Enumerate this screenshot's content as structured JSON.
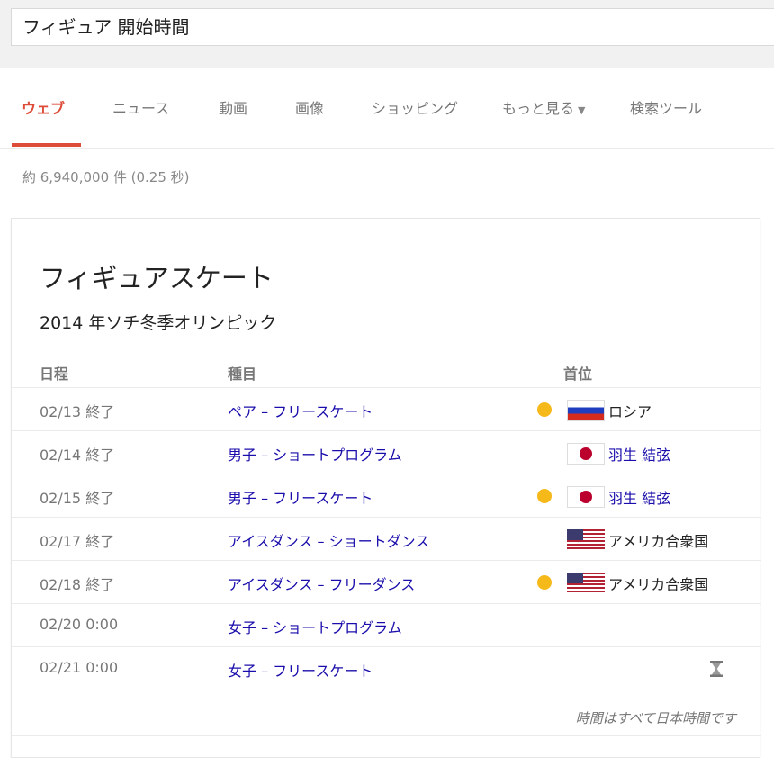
{
  "search": {
    "query": "フィギュア  開始時間"
  },
  "tabs": [
    {
      "label": "ウェブ",
      "active": true
    },
    {
      "label": "ニュース"
    },
    {
      "label": "動画"
    },
    {
      "label": "画像"
    },
    {
      "label": "ショッピング"
    },
    {
      "label": "もっと見る"
    },
    {
      "label": "検索ツール"
    }
  ],
  "result_stats": "約 6,940,000 件 (0.25 秒)",
  "card": {
    "title": "フィギュアスケート",
    "subtitle": "2014 年ソチ冬季オリンピック",
    "columns": {
      "date": "日程",
      "event": "種目",
      "winner": "首位"
    },
    "rows": [
      {
        "date": "02/13 終了",
        "event": "ペア – フリースケート",
        "gold": true,
        "flag": "russia-flag-icon",
        "winner": "ロシア",
        "winner_link": false
      },
      {
        "date": "02/14 終了",
        "event": "男子 – ショートプログラム",
        "gold": false,
        "flag": "japan-flag-icon",
        "winner": "羽生 結弦",
        "winner_link": true
      },
      {
        "date": "02/15 終了",
        "event": "男子 – フリースケート",
        "gold": true,
        "flag": "japan-flag-icon",
        "winner": "羽生 結弦",
        "winner_link": true
      },
      {
        "date": "02/17 終了",
        "event": "アイスダンス – ショートダンス",
        "gold": false,
        "flag": "usa-flag-icon",
        "winner": "アメリカ合衆国",
        "winner_link": false
      },
      {
        "date": "02/18 終了",
        "event": "アイスダンス – フリーダンス",
        "gold": true,
        "flag": "usa-flag-icon",
        "winner": "アメリカ合衆国",
        "winner_link": false
      },
      {
        "date": "02/20 0:00",
        "event": "女子 – ショートプログラム",
        "gold": false,
        "flag": "",
        "winner": "",
        "winner_link": false
      },
      {
        "date": "02/21 0:00",
        "event": "女子 – フリースケート",
        "gold": false,
        "flag": "",
        "winner": "",
        "winner_link": false,
        "hourglass": true
      }
    ],
    "footnote": "時間はすべて日本時間です"
  },
  "colors": {
    "accent": "#dd4b39",
    "link": "#1a0dab",
    "gold": "#f6b91a"
  }
}
